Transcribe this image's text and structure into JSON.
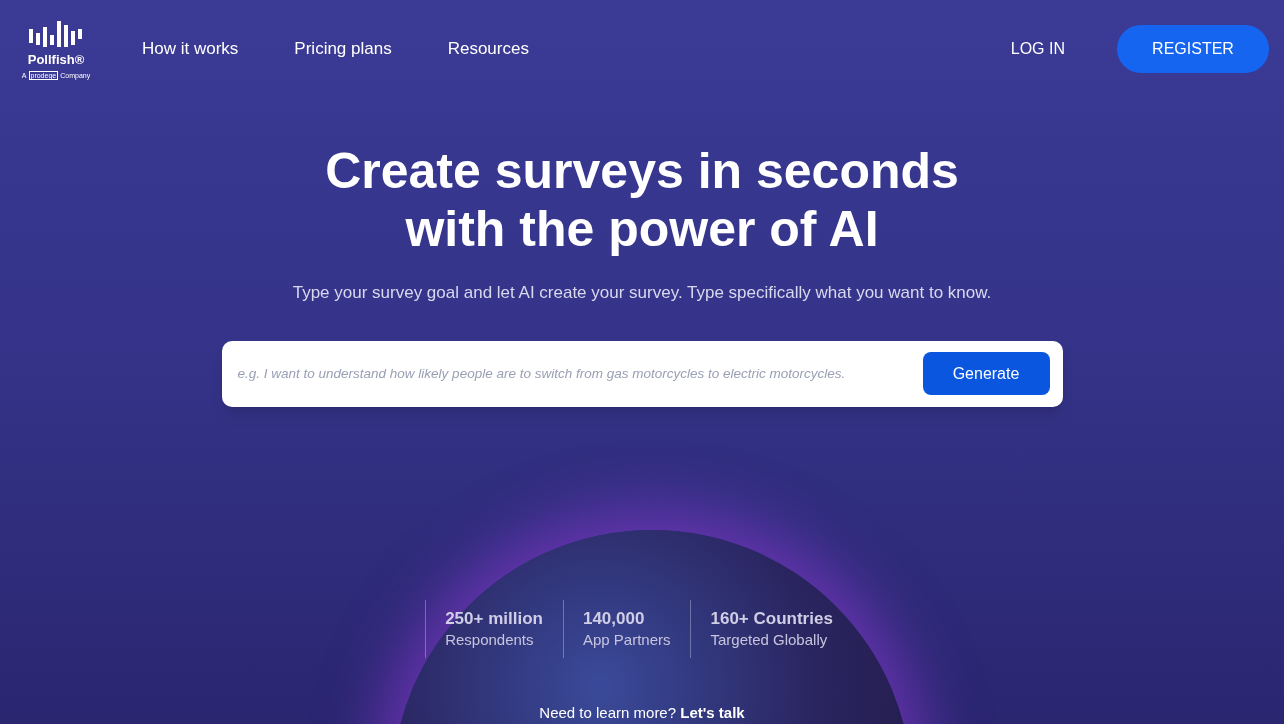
{
  "logo": {
    "name": "Pollfish®",
    "tagline_prefix": "A",
    "tagline_brand": "prodege",
    "tagline_suffix": "Company"
  },
  "nav": [
    {
      "label": "How it works"
    },
    {
      "label": "Pricing plans"
    },
    {
      "label": "Resources"
    }
  ],
  "login": "LOG IN",
  "register": "REGISTER",
  "hero": {
    "title_line_1": "Create surveys in seconds",
    "title_line_2": "with the power of AI",
    "subtitle": "Type your survey goal and let AI create your survey. Type specifically what you want to know."
  },
  "prompt": {
    "placeholder": "e.g. I want to understand how likely people are to switch from gas motorcycles to electric motorcycles.",
    "button": "Generate"
  },
  "stats": [
    {
      "value": "250+ million",
      "label": "Respondents"
    },
    {
      "value": "140,000",
      "label": "App Partners"
    },
    {
      "value": "160+ Countries",
      "label": "Targeted Globally"
    }
  ],
  "footer": {
    "question": "Need to learn more?",
    "link": "Let's talk"
  }
}
